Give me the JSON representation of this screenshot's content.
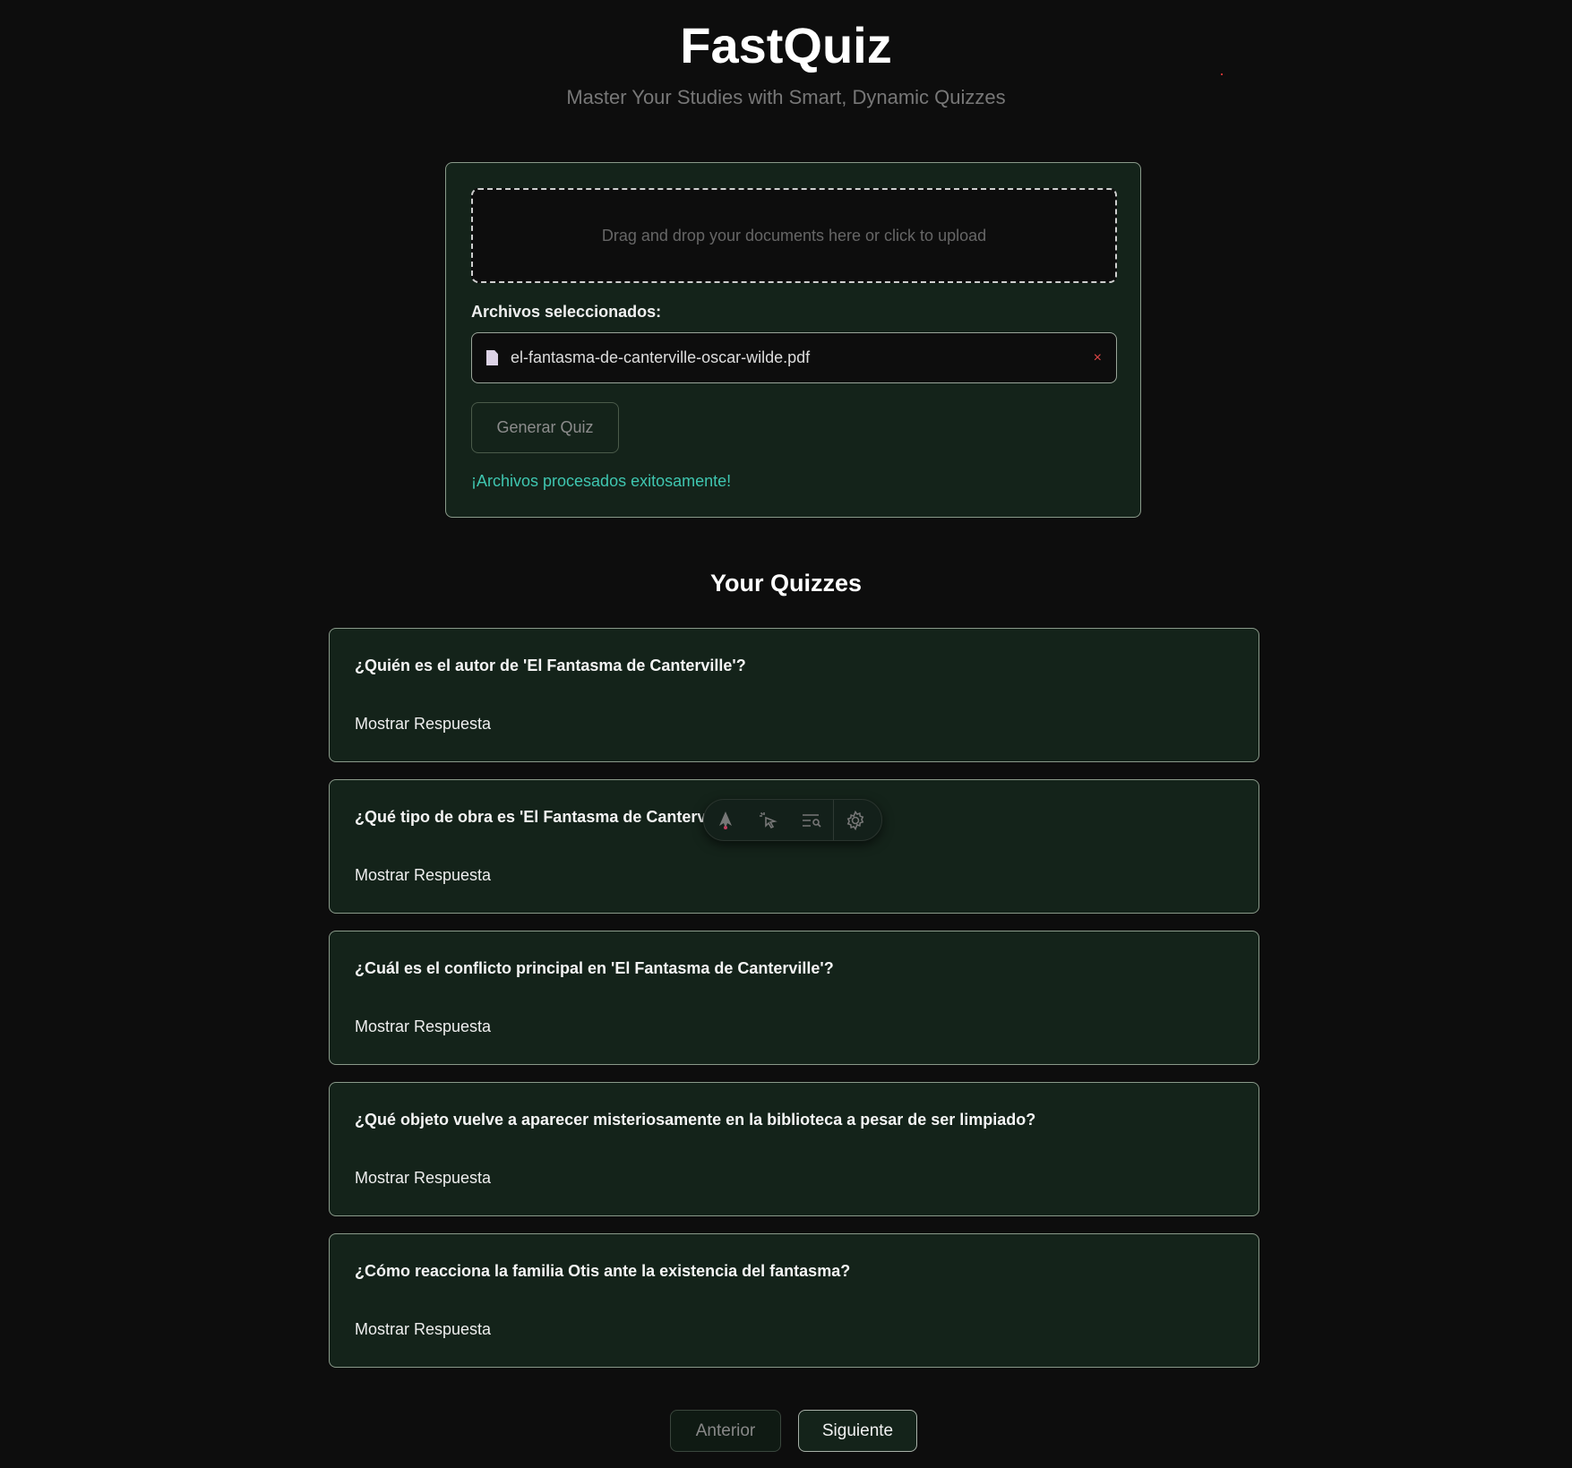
{
  "header": {
    "title": "FastQuiz",
    "subtitle": "Master Your Studies with Smart, Dynamic Quizzes"
  },
  "upload": {
    "dropzone_text": "Drag and drop your documents here or click to upload",
    "selected_label": "Archivos seleccionados:",
    "files": [
      {
        "name": "el-fantasma-de-canterville-oscar-wilde.pdf",
        "icon": "file-icon",
        "remove": "×"
      }
    ],
    "generate_label": "Generar Quiz",
    "status": "¡Archivos procesados exitosamente!",
    "status_color": "#3fc6b0"
  },
  "quizzes": {
    "title": "Your Quizzes",
    "items": [
      {
        "question": "¿Quién es el autor de 'El Fantasma de Canterville'?",
        "action": "Mostrar Respuesta"
      },
      {
        "question": "¿Qué tipo de obra es 'El Fantasma de Canterville'?",
        "action": "Mostrar Respuesta"
      },
      {
        "question": "¿Cuál es el conflicto principal en 'El Fantasma de Canterville'?",
        "action": "Mostrar Respuesta"
      },
      {
        "question": "¿Qué objeto vuelve a aparecer misteriosamente en la biblioteca a pesar de ser limpiado?",
        "action": "Mostrar Respuesta"
      },
      {
        "question": "¿Cómo reacciona la familia Otis ante la existencia del fantasma?",
        "action": "Mostrar Respuesta"
      }
    ]
  },
  "pagination": {
    "prev": "Anterior",
    "next": "Siguiente"
  },
  "overlay_toolbar": {
    "icons": [
      "rocket-icon",
      "cursor-click-icon",
      "search-list-icon",
      "gear-icon"
    ]
  }
}
